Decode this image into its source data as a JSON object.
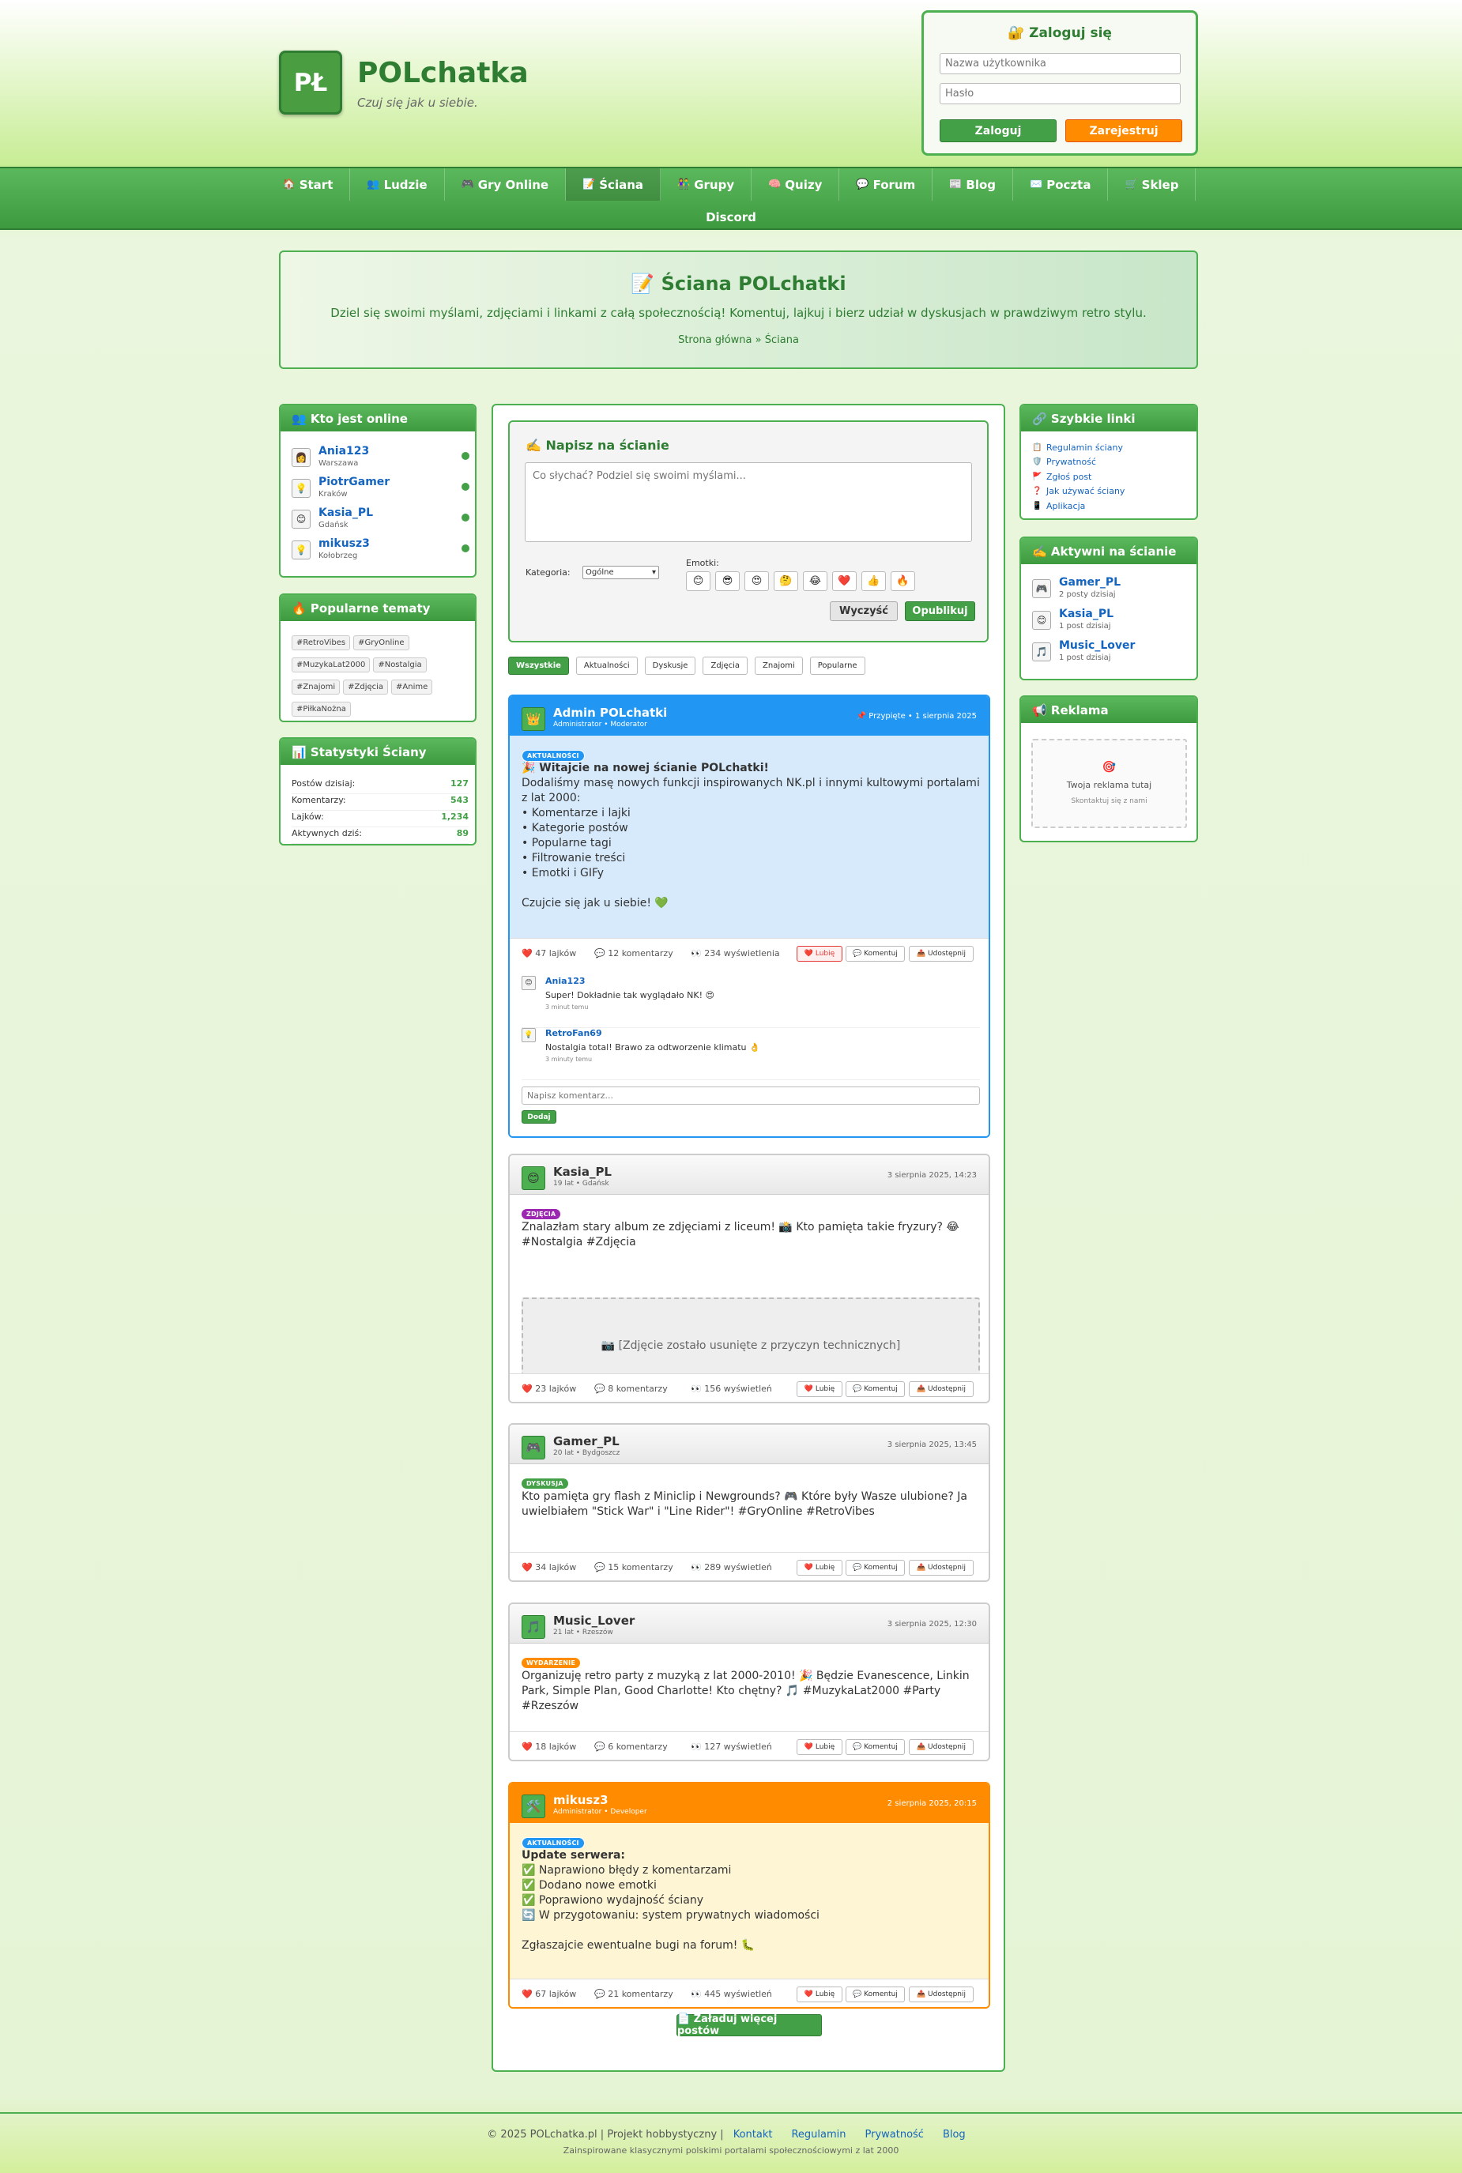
{
  "header": {
    "logo": "PŁ",
    "title": "POLchatka",
    "tagline": "Czuj się jak u siebie."
  },
  "login": {
    "title": "🔐 Zaloguj się",
    "username_placeholder": "Nazwa użytkownika",
    "password_placeholder": "Hasło",
    "login_btn": "Zaloguj",
    "register_btn": "Zarejestruj"
  },
  "nav": [
    {
      "icon": "🏠",
      "label": "Start"
    },
    {
      "icon": "👥",
      "label": "Ludzie"
    },
    {
      "icon": "🎮",
      "label": "Gry Online"
    },
    {
      "icon": "📝",
      "label": "Ściana"
    },
    {
      "icon": "👫",
      "label": "Grupy"
    },
    {
      "icon": "🧠",
      "label": "Quizy"
    },
    {
      "icon": "💬",
      "label": "Forum"
    },
    {
      "icon": "📰",
      "label": "Blog"
    },
    {
      "icon": "✉️",
      "label": "Poczta"
    },
    {
      "icon": "🛒",
      "label": "Sklep"
    }
  ],
  "nav_discord": "Discord",
  "hero": {
    "title": "📝 Ściana POLchatki",
    "subtitle": "Dziel się swoimi myślami, zdjęciami i linkami z całą społecznością! Komentuj, lajkuj i bierz udział w dyskusjach w prawdziwym retro stylu.",
    "breadcrumb": "Strona główna » Ściana"
  },
  "online": {
    "title": "👥 Kto jest online",
    "users": [
      {
        "name": "Ania123",
        "city": "Warszawa",
        "avatar": "👩"
      },
      {
        "name": "PiotrGamer",
        "city": "Kraków",
        "avatar": "💡"
      },
      {
        "name": "Kasia_PL",
        "city": "Gdańsk",
        "avatar": "😊"
      },
      {
        "name": "mikusz3",
        "city": "Kołobrzeg",
        "avatar": "💡"
      }
    ]
  },
  "popular": {
    "title": "🔥 Popularne tematy",
    "tags": [
      "#RetroVibes",
      "#GryOnline",
      "#MuzykaLat2000",
      "#Nostalgia",
      "#Znajomi",
      "#Zdjęcia",
      "#Anime",
      "#PiłkaNożna"
    ]
  },
  "stats": {
    "title": "📊 Statystyki Ściany",
    "rows": [
      {
        "label": "Postów dzisiaj:",
        "value": "127"
      },
      {
        "label": "Komentarzy:",
        "value": "543"
      },
      {
        "label": "Lajków:",
        "value": "1,234"
      },
      {
        "label": "Aktywnych dziś:",
        "value": "89"
      }
    ]
  },
  "composer": {
    "title": "✍️ Napisz na ścianie",
    "placeholder": "Co słychać? Podziel się swoimi myślami...",
    "category_label": "Kategoria:",
    "category_value": "Ogólne",
    "emotes_label": "Emotki:",
    "emotes": [
      "😊",
      "😎",
      "😍",
      "🤔",
      "😂",
      "❤️",
      "👍",
      "🔥"
    ],
    "clear_btn": "Wyczyść",
    "publish_btn": "Opublikuj"
  },
  "filters": [
    "Wszystkie",
    "Aktualności",
    "Dyskusje",
    "Zdjęcia",
    "Znajomi",
    "Popularne"
  ],
  "posts": [
    {
      "author": "Admin POLchatki",
      "meta": "Administrator • Moderator",
      "date": "📌 Przypięte • 1 sierpnia 2025",
      "avatar": "👑",
      "badge": "AKTUALNOŚCI",
      "title": "🎉 Witajcie na nowej ścianie POLchatki!",
      "text": "Dodaliśmy masę nowych funkcji inspirowanych NK.pl i innymi kultowymi portalami z lat 2000:\n• Komentarze i lajki\n• Kategorie postów\n• Popularne tagi\n• Filtrowanie treści\n• Emotki i GIFy\n\nCzujcie się jak u siebie! 💚",
      "likes": "47 lajków",
      "comments": "12 komentarzy",
      "views": "234 wyświetlenia"
    },
    {
      "author": "Kasia_PL",
      "meta": "19 lat • Gdańsk",
      "date": "3 sierpnia 2025, 14:23",
      "avatar": "😊",
      "badge": "ZDJĘCIA",
      "text": "Znalazłam stary album ze zdjęciami z liceum! 📸 Kto pamięta takie fryzury? 😂\n#Nostalgia #Zdjęcia",
      "photo": "📷 [Zdjęcie zostało usunięte z przyczyn technicznych]",
      "likes": "23 lajków",
      "comments": "8 komentarzy",
      "views": "156 wyświetleń"
    },
    {
      "author": "Gamer_PL",
      "meta": "20 lat • Bydgoszcz",
      "date": "3 sierpnia 2025, 13:45",
      "avatar": "🎮",
      "badge": "DYSKUSJA",
      "text": "Kto pamięta gry flash z Miniclip i Newgrounds? 🎮 Które były Wasze ulubione? Ja uwielbiałem \"Stick War\" i \"Line Rider\"! #GryOnline #RetroVibes",
      "likes": "34 lajków",
      "comments": "15 komentarzy",
      "views": "289 wyświetleń"
    },
    {
      "author": "Music_Lover",
      "meta": "21 lat • Rzeszów",
      "date": "3 sierpnia 2025, 12:30",
      "avatar": "🎵",
      "badge": "WYDARZENIE",
      "text": "Organizuję retro party z muzyką z lat 2000-2010! 🎉 Będzie Evanescence, Linkin Park, Simple Plan, Good Charlotte! Kto chętny? 🎵 #MuzykaLat2000 #Party #Rzeszów",
      "likes": "18 lajków",
      "comments": "6 komentarzy",
      "views": "127 wyświetleń"
    },
    {
      "author": "mikusz3",
      "meta": "Administrator • Developer",
      "date": "2 sierpnia 2025, 20:15",
      "avatar": "🛠️",
      "badge": "AKTUALNOŚCI",
      "title": "Update serwera:",
      "text": "✅ Naprawiono błędy z komentarzami\n✅ Dodano nowe emotki\n✅ Poprawiono wydajność ściany\n🔄 W przygotowaniu: system prywatnych wiadomości\n\nZgłaszajcie ewentualne bugi na forum! 🐛",
      "likes": "67 lajków",
      "comments": "21 komentarzy",
      "views": "445 wyświetleń"
    }
  ],
  "post_actions": {
    "like": "❤️ Lubię",
    "comment": "💬 Komentuj",
    "share": "📤 Udostępnij"
  },
  "comments": [
    {
      "name": "Ania123",
      "text": "Super! Dokładnie tak wyglądało NK! 😍",
      "time": "3 minut temu",
      "avatar": "😊"
    },
    {
      "name": "RetroFan69",
      "text": "Nostalgia total! Brawo za odtworzenie klimatu 👌",
      "time": "3 minuty temu",
      "avatar": "💡"
    }
  ],
  "comment_input": {
    "placeholder": "Napisz komentarz...",
    "add": "Dodaj"
  },
  "load_more": "📄 Załaduj więcej postów",
  "quick_links": {
    "title": "🔗 Szybkie linki",
    "items": [
      {
        "icon": "📋",
        "label": "Regulamin ściany"
      },
      {
        "icon": "🛡️",
        "label": "Prywatność"
      },
      {
        "icon": "🚩",
        "label": "Zgłoś post"
      },
      {
        "icon": "❓",
        "label": "Jak używać ściany"
      },
      {
        "icon": "📱",
        "label": "Aplikacja"
      }
    ]
  },
  "active": {
    "title": "✍️ Aktywni na ścianie",
    "users": [
      {
        "name": "Gamer_PL",
        "posts": "2 posty dzisiaj",
        "avatar": "🎮"
      },
      {
        "name": "Kasia_PL",
        "posts": "1 post dzisiaj",
        "avatar": "😊"
      },
      {
        "name": "Music_Lover",
        "posts": "1 post dzisiaj",
        "avatar": "🎵"
      }
    ]
  },
  "ads": {
    "title": "📢 Reklama",
    "icon": "🎯",
    "text": "Twoja reklama tutaj",
    "sub": "Skontaktuj się z nami"
  },
  "footer": {
    "copy": "© 2025 POLchatka.pl | Projekt hobbystyczny |",
    "links": [
      "Kontakt",
      "Regulamin",
      "Prywatność",
      "Blog"
    ],
    "sub": "Zainspirowane klasycznymi polskimi portalami społecznościowymi z lat 2000"
  }
}
